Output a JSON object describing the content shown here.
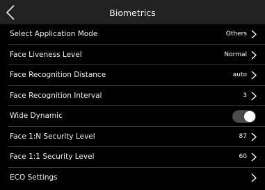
{
  "header": {
    "title": "Biometrics"
  },
  "settings": [
    {
      "label": "Select Application Mode",
      "value": "Others"
    },
    {
      "label": "Face Liveness Level",
      "value": "Normal"
    },
    {
      "label": "Face Recognition Distance",
      "value": "auto"
    },
    {
      "label": "Face Recognition Interval",
      "value": "3"
    },
    {
      "label": "Wide Dynamic",
      "toggle_state": "on"
    },
    {
      "label": "Face 1:N Security Level",
      "value": "87"
    },
    {
      "label": "Face 1:1 Security Level",
      "value": "60"
    },
    {
      "label": "ECO Settings",
      "value": ""
    }
  ],
  "icons": {
    "back": "chevron-left-icon",
    "row_arrow": "chevron-right-icon"
  },
  "colors": {
    "background": "#000000",
    "header_background": "#222222",
    "divider": "#3a3a3a",
    "toggle_track": "#4a4a4a",
    "toggle_knob": "#ffffff"
  }
}
